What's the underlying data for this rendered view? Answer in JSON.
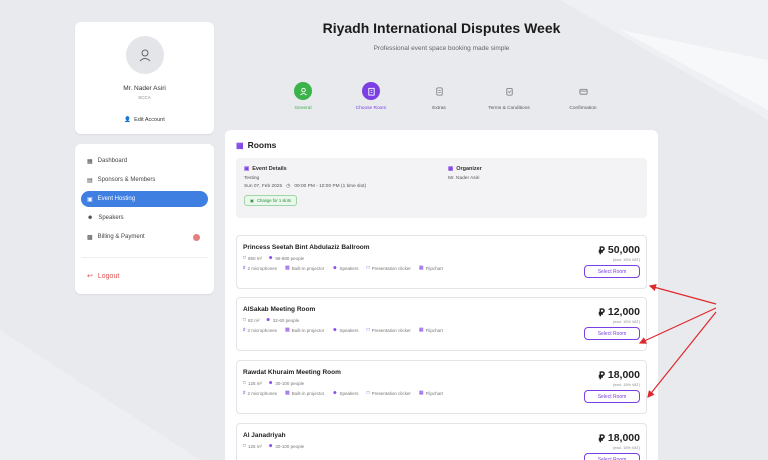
{
  "header": {
    "title": "Riyadh International Disputes Week",
    "subtitle": "Professional event space booking made simple"
  },
  "profile": {
    "name": "Mr. Nader Asiri",
    "org": "SCCA",
    "edit_label": "Edit Account"
  },
  "nav": {
    "items": [
      {
        "label": "Dashboard",
        "icon": "grid-icon"
      },
      {
        "label": "Sponsors & Members",
        "icon": "card-icon"
      },
      {
        "label": "Event Hosting",
        "icon": "calendar-icon",
        "active": true
      },
      {
        "label": "Speakers",
        "icon": "users-icon"
      },
      {
        "label": "Billing & Payment",
        "icon": "wallet-icon",
        "badge": true
      }
    ],
    "logout_label": "Logout"
  },
  "stepper": {
    "steps": [
      {
        "label": "General",
        "state": "done"
      },
      {
        "label": "Choose Room",
        "state": "current"
      },
      {
        "label": "Extras",
        "state": "todo"
      },
      {
        "label": "Terms & Conditions",
        "state": "todo"
      },
      {
        "label": "Confirmation",
        "state": "todo"
      }
    ]
  },
  "rooms": {
    "section_title": "Rooms",
    "event_details": {
      "title": "Event Details",
      "name": "Testing",
      "date": "Sun 07, Feb 2025",
      "time": "09:00 PM - 10:00 PM (1 time slot)",
      "change_label": "Change for 1 slots"
    },
    "organizer": {
      "title": "Organizer",
      "name": "Mr. Nader Asiri"
    },
    "vat_note": "(excl. 15% VAT)",
    "select_label": "Select Room",
    "amenities": [
      "2 microphones",
      "Built-in projector",
      "Speakers",
      "Presentation clicker",
      "Flipchart"
    ],
    "list": [
      {
        "name": "Princess Seetah Bint Abdulaziz Ballroom",
        "area": "850 m²",
        "capacity": "96-880 people",
        "price": "50,000"
      },
      {
        "name": "AlSakab Meeting Room",
        "area": "82 m²",
        "capacity": "32-60 people",
        "price": "12,000"
      },
      {
        "name": "Rawdat Khuraim Meeting Room",
        "area": "125 m²",
        "capacity": "30-100 people",
        "price": "18,000"
      },
      {
        "name": "Al Janadriyah",
        "area": "125 m²",
        "capacity": "30-100 people",
        "price": "18,000"
      }
    ]
  },
  "colors": {
    "accent": "#7b3fe4",
    "active_nav": "#3f7fe2",
    "done_step": "#3cb24a",
    "annotation_arrow": "#e0282c"
  }
}
